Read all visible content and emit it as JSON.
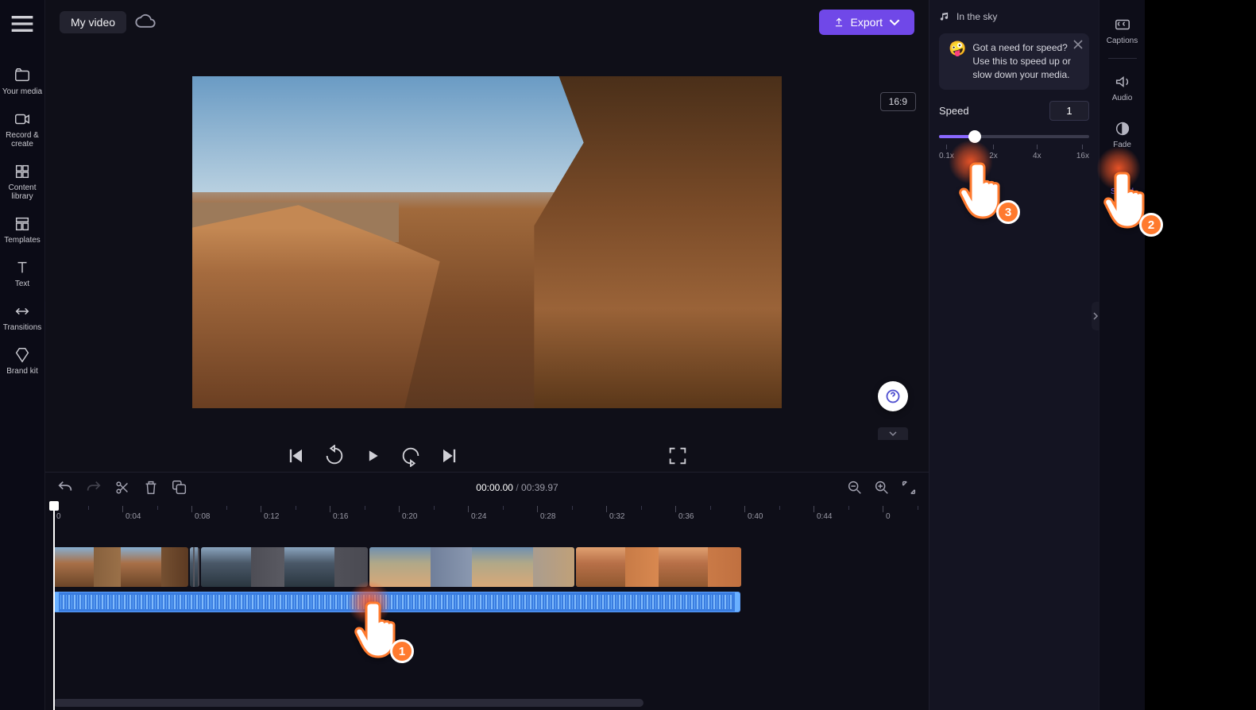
{
  "leftnav": {
    "items": [
      {
        "label": "Your media"
      },
      {
        "label": "Record & create"
      },
      {
        "label": "Content library"
      },
      {
        "label": "Templates"
      },
      {
        "label": "Text"
      },
      {
        "label": "Transitions"
      },
      {
        "label": "Brand kit"
      }
    ]
  },
  "topbar": {
    "title": "My video",
    "export": "Export"
  },
  "preview": {
    "ratio": "16:9"
  },
  "timeline": {
    "current": "00:00.00",
    "sep": "/",
    "duration": "00:39.97",
    "ruler": [
      "0",
      "0:04",
      "0:08",
      "0:12",
      "0:16",
      "0:20",
      "0:24",
      "0:28",
      "0:32",
      "0:36",
      "0:40",
      "0:44",
      "0"
    ]
  },
  "rightpanel": {
    "audio_name": "In the sky",
    "tip": "Got a need for speed? Use this to speed up or slow down your media.",
    "speed_label": "Speed",
    "speed_value": "1",
    "ticks": [
      "0.1x",
      "2x",
      "4x",
      "16x"
    ]
  },
  "rightnav": {
    "items": [
      {
        "label": "Captions"
      },
      {
        "label": "Audio"
      },
      {
        "label": "Fade"
      },
      {
        "label": "Speed"
      }
    ]
  },
  "pointers": {
    "p1": "1",
    "p2": "2",
    "p3": "3"
  }
}
